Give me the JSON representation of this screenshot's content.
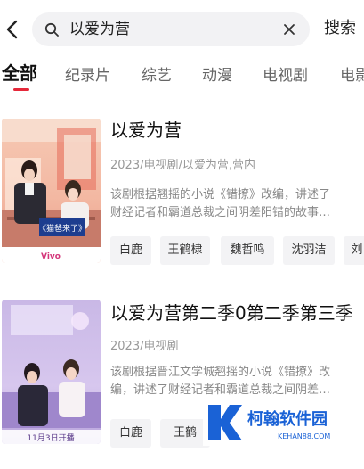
{
  "search": {
    "query": "以爱为营",
    "button_label": "搜索"
  },
  "tabs": [
    {
      "label": "全部",
      "active": true
    },
    {
      "label": "纪录片"
    },
    {
      "label": "综艺"
    },
    {
      "label": "动漫"
    },
    {
      "label": "电视剧"
    },
    {
      "label": "电影"
    }
  ],
  "results": [
    {
      "title": "以爱为营",
      "meta": "2023/电视剧/以爱为营,营内",
      "description_lines": [
        "该剧根据翘摇的小说《错撩》改编，讲述了",
        "财经记者和霸道总裁之间阴差阳错的故事…"
      ],
      "poster_texts": [
        "《猫爸来了》",
        "Vivo"
      ],
      "cast": [
        "白鹿",
        "王鹤棣",
        "魏哲鸣",
        "沈羽洁",
        "刘"
      ]
    },
    {
      "title": "以爱为营第二季0第二季第三季",
      "meta": "2023/电视剧",
      "description_lines": [
        "该剧根据晋江文学城翘摇的小说《错撩》改",
        "编，讲述了财经记者和霸道总裁之间阴差…"
      ],
      "poster_texts": [
        "11月3日开播"
      ],
      "cast": [
        "白鹿",
        "王鹤"
      ]
    }
  ],
  "watermark": {
    "brand": "柯翰软件园",
    "domain": "KEHAN88.COM"
  },
  "colors": {
    "accent": "#e5283a",
    "watermark_blue": "#1a62d6"
  }
}
